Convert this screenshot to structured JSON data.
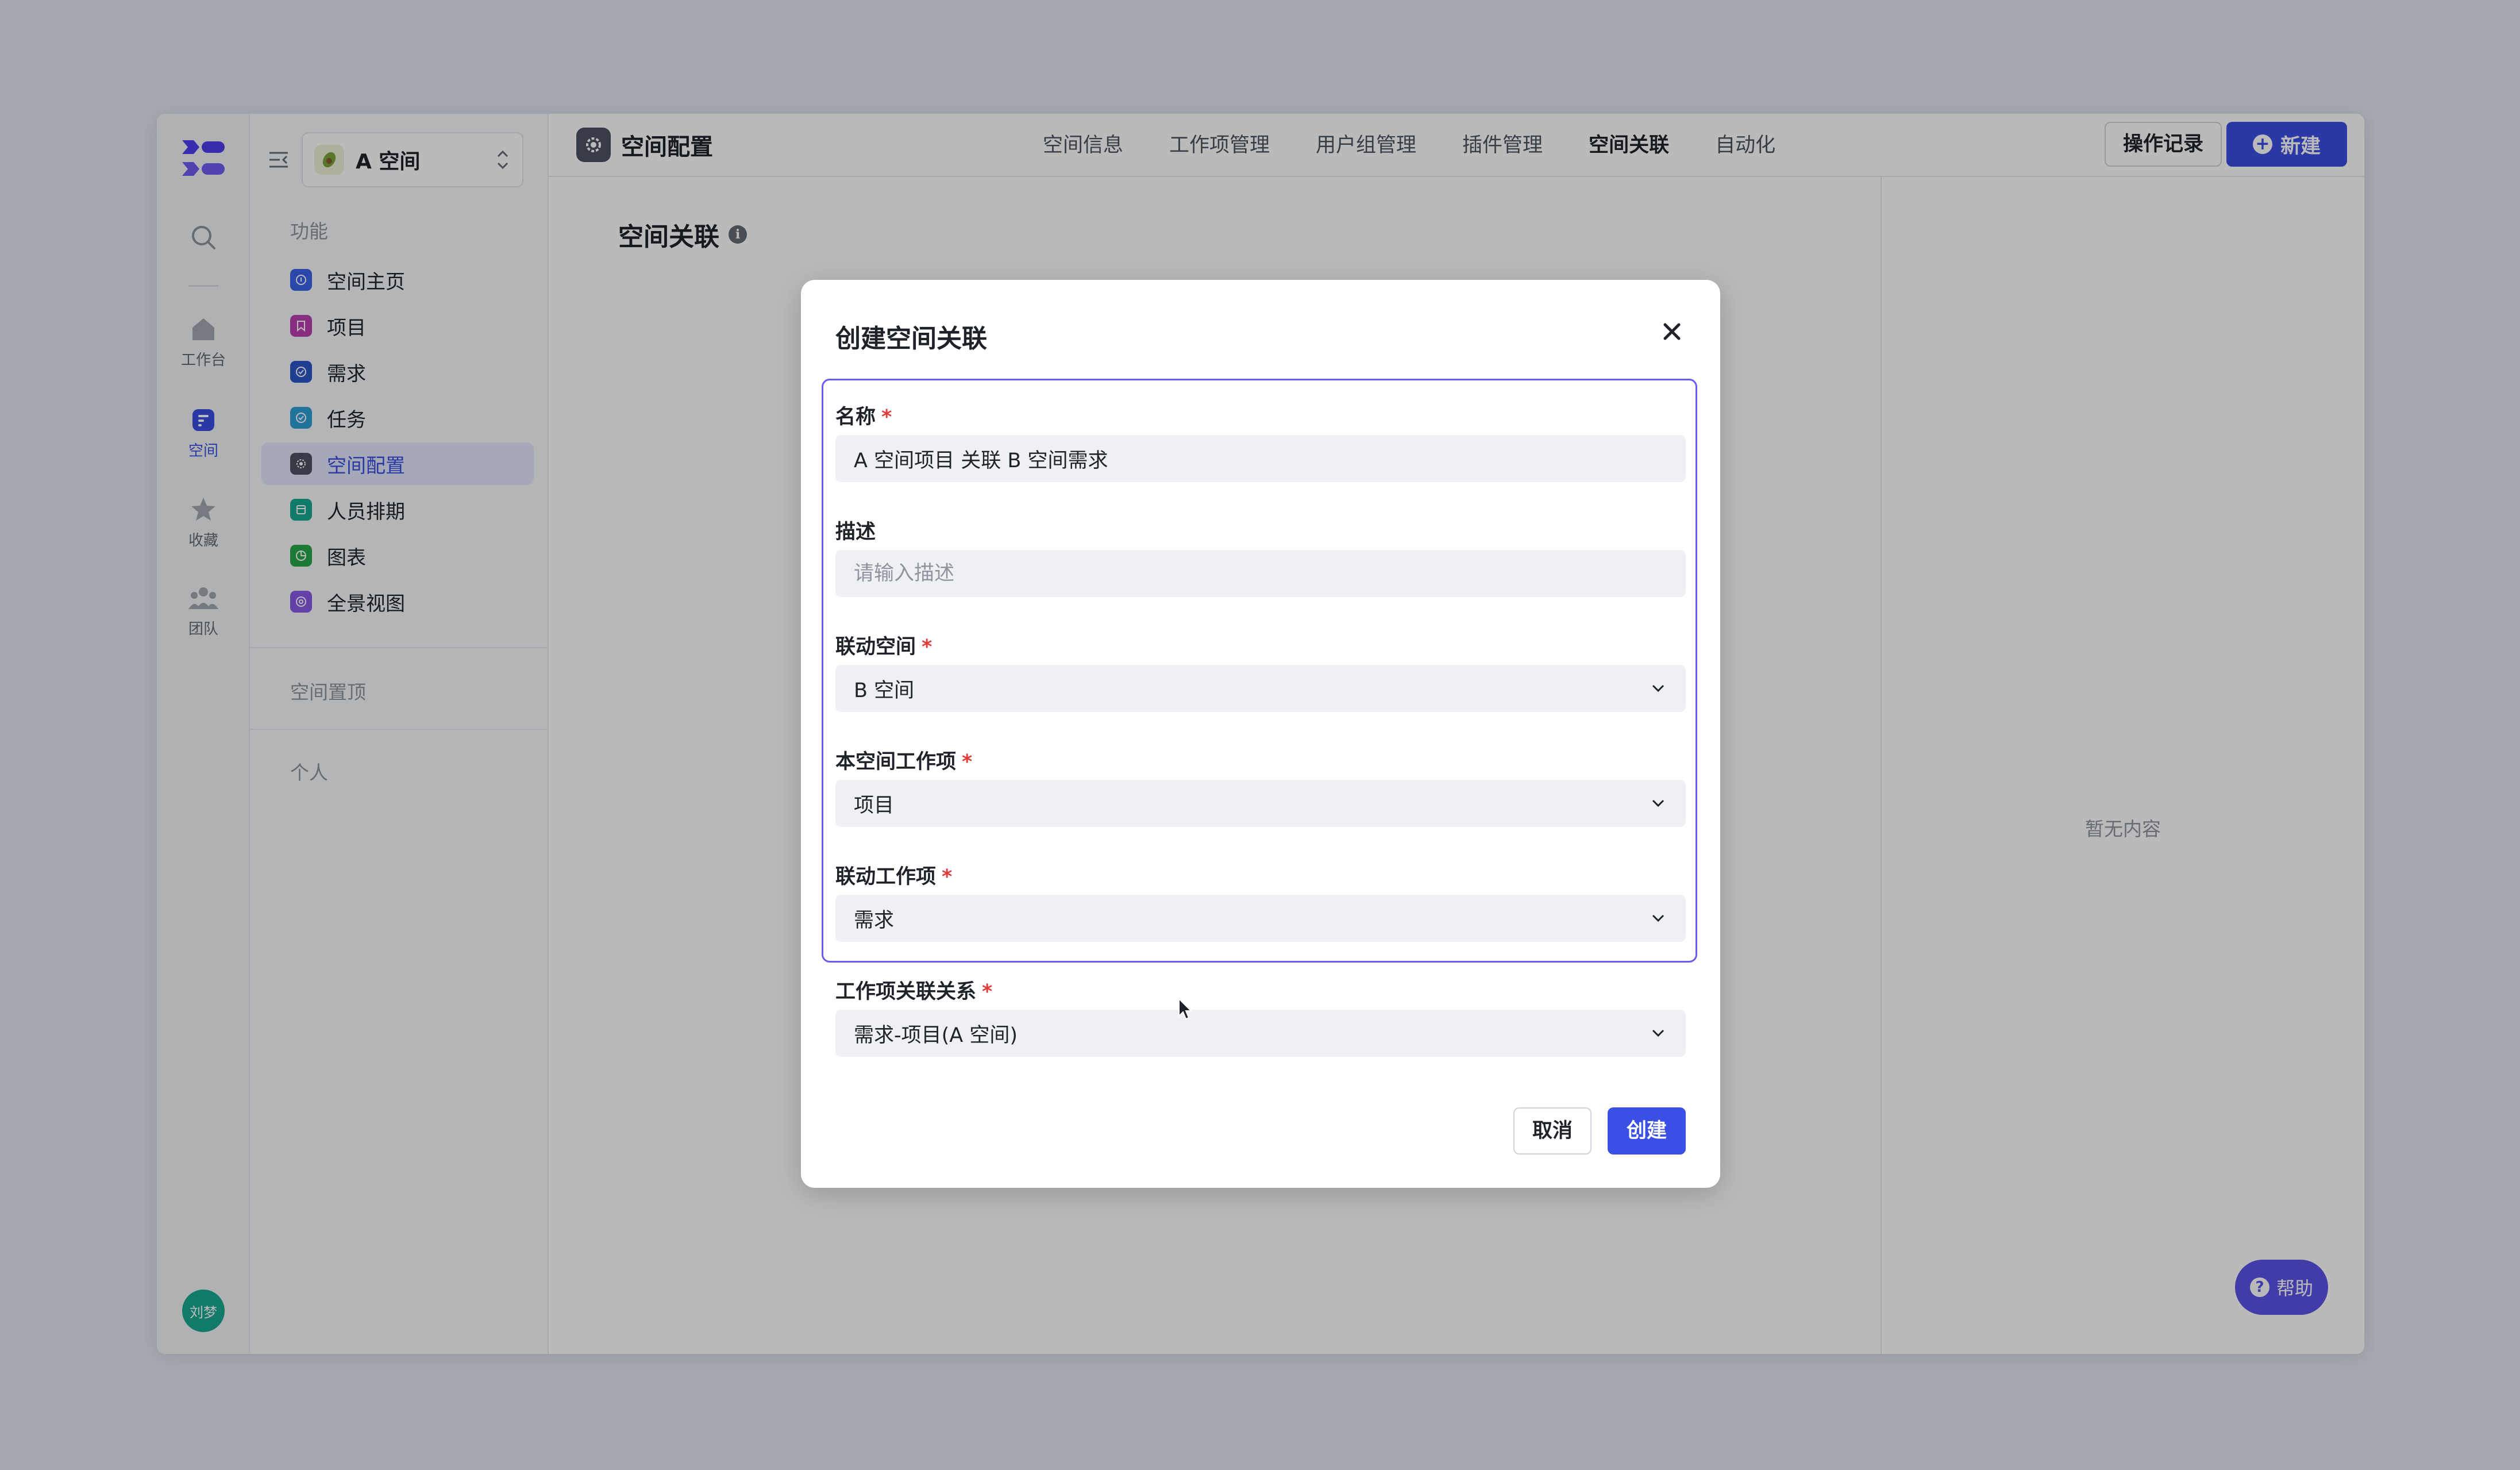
{
  "rail": {
    "items": [
      {
        "icon": "search-icon",
        "label": ""
      },
      {
        "icon": "home-icon",
        "label": "工作台"
      },
      {
        "icon": "space-icon",
        "label": "空间"
      },
      {
        "icon": "star-icon",
        "label": "收藏"
      },
      {
        "icon": "team-icon",
        "label": "团队"
      }
    ],
    "avatar_text": "刘梦"
  },
  "sidebar": {
    "space_name": "A 空间",
    "section_features": "功能",
    "items": [
      {
        "label": "空间主页",
        "color": "#3a62e8"
      },
      {
        "label": "项目",
        "color": "#b93fb0"
      },
      {
        "label": "需求",
        "color": "#2d56c8"
      },
      {
        "label": "任务",
        "color": "#2c9fd6"
      },
      {
        "label": "空间配置",
        "color": "#4c5260"
      },
      {
        "label": "人员排期",
        "color": "#1aa88f"
      },
      {
        "label": "图表",
        "color": "#27a84a"
      },
      {
        "label": "全景视图",
        "color": "#8a5ae6"
      }
    ],
    "section_pinned": "空间置顶",
    "section_personal": "个人"
  },
  "header": {
    "title": "空间配置",
    "tabs": [
      "空间信息",
      "工作项管理",
      "用户组管理",
      "插件管理",
      "空间关联",
      "自动化"
    ],
    "active_tab": "空间关联",
    "log_button": "操作记录",
    "new_button": "新建"
  },
  "main": {
    "title": "空间关联",
    "empty_text": "暂无内容",
    "help_label": "帮助"
  },
  "modal": {
    "title": "创建空间关联",
    "fields": {
      "name": {
        "label": "名称",
        "value": "A 空间项目 关联 B 空间需求"
      },
      "description": {
        "label": "描述",
        "placeholder": "请输入描述"
      },
      "linked_space": {
        "label": "联动空间",
        "value": "B 空间"
      },
      "local_item": {
        "label": "本空间工作项",
        "value": "项目"
      },
      "linked_item": {
        "label": "联动工作项",
        "value": "需求"
      },
      "relation": {
        "label": "工作项关联关系",
        "value": "需求-项目(A 空间)"
      }
    },
    "cancel_label": "取消",
    "create_label": "创建"
  },
  "colors": {
    "accent": "#3a4fe3",
    "focus": "#6b5cf0",
    "required": "#e33b3b"
  }
}
